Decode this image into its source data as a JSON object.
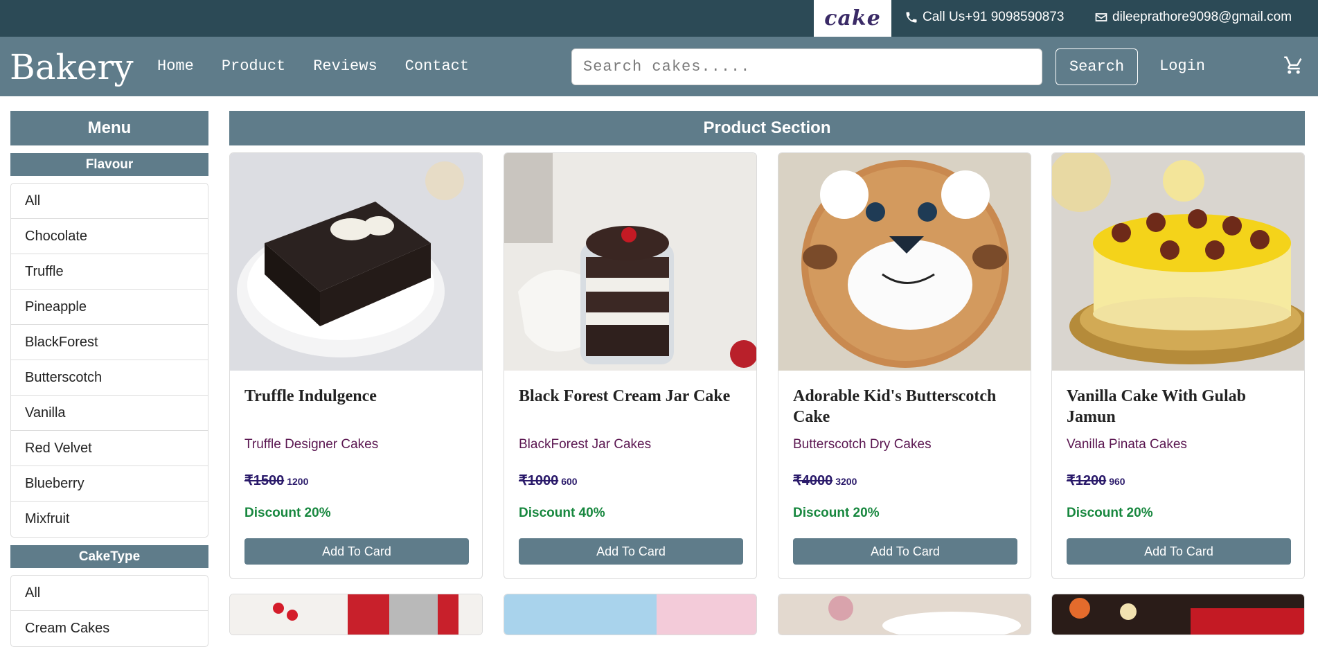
{
  "topbar": {
    "logo_text": "cake",
    "phone": "Call Us+91 9098590873",
    "email": "dileeprathore9098@gmail.com"
  },
  "nav": {
    "brand": "Bakery",
    "links": [
      "Home",
      "Product",
      "Reviews",
      "Contact"
    ],
    "search_placeholder": "Search cakes.....",
    "search_button": "Search",
    "login": "Login",
    "cart_icon": "cart-icon"
  },
  "sidebar": {
    "menu_title": "Menu",
    "flavour_title": "Flavour",
    "flavours": [
      "All",
      "Chocolate",
      "Truffle",
      "Pineapple",
      "BlackForest",
      "Butterscotch",
      "Vanilla",
      "Red Velvet",
      "Blueberry",
      "Mixfruit"
    ],
    "caketype_title": "CakeType",
    "caketypes": [
      "All",
      "Cream Cakes"
    ]
  },
  "products": {
    "section_title": "Product Section",
    "items": [
      {
        "title": "Truffle Indulgence",
        "category": "Truffle Designer Cakes",
        "old_price": "₹1500",
        "new_price": "1200",
        "discount": "Discount 20%",
        "button": "Add To Card"
      },
      {
        "title": "Black Forest Cream Jar Cake",
        "category": "BlackForest Jar Cakes",
        "old_price": "₹1000",
        "new_price": "600",
        "discount": "Discount 40%",
        "button": "Add To Card"
      },
      {
        "title": "Adorable Kid's Butterscotch Cake",
        "category": "Butterscotch Dry Cakes",
        "old_price": "₹4000",
        "new_price": "3200",
        "discount": "Discount 20%",
        "button": "Add To Card"
      },
      {
        "title": "Vanilla Cake With Gulab Jamun",
        "category": "Vanilla Pinata Cakes",
        "old_price": "₹1200",
        "new_price": "960",
        "discount": "Discount 20%",
        "button": "Add To Card"
      }
    ]
  },
  "colors": {
    "topbar": "#2c4a56",
    "navbar": "#5f7c8a",
    "discount": "#17873e",
    "category": "#5a1650"
  }
}
